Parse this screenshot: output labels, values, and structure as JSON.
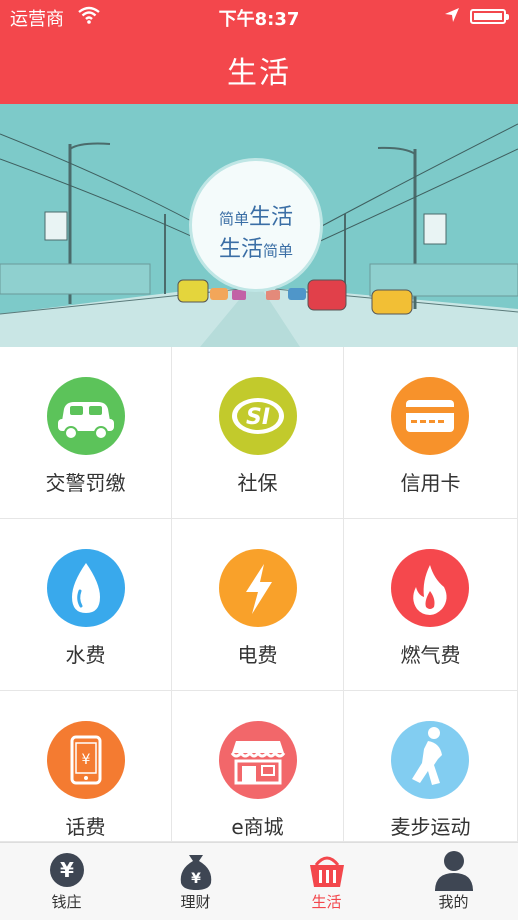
{
  "status_bar": {
    "carrier": "运营商",
    "time": "下午8:37"
  },
  "header": {
    "title": "生活"
  },
  "banner": {
    "line1_small": "简单",
    "line1_big": "生活",
    "line2_big": "生活",
    "line2_small": "简单"
  },
  "services": [
    {
      "label": "交警罚缴",
      "icon": "car-icon",
      "color": "#5cc35a"
    },
    {
      "label": "社保",
      "icon": "social-security-icon",
      "color": "#c2ca2c"
    },
    {
      "label": "信用卡",
      "icon": "credit-card-icon",
      "color": "#f7922b"
    },
    {
      "label": "水费",
      "icon": "water-drop-icon",
      "color": "#39a9ec"
    },
    {
      "label": "电费",
      "icon": "lightning-icon",
      "color": "#f9a12a"
    },
    {
      "label": "燃气费",
      "icon": "flame-icon",
      "color": "#f5484d"
    },
    {
      "label": "话费",
      "icon": "phone-bill-icon",
      "color": "#f47b31"
    },
    {
      "label": "e商城",
      "icon": "store-icon",
      "color": "#f2676a"
    },
    {
      "label": "麦步运动",
      "icon": "runner-icon",
      "color": "#82cdf1"
    }
  ],
  "tabs": [
    {
      "label": "钱庄",
      "icon": "yen-coin-icon",
      "active": false
    },
    {
      "label": "理财",
      "icon": "money-bag-icon",
      "active": false
    },
    {
      "label": "生活",
      "icon": "basket-icon",
      "active": true
    },
    {
      "label": "我的",
      "icon": "person-icon",
      "active": false
    }
  ],
  "colors": {
    "header": "#f3474c",
    "banner": "#7dcac9",
    "active_tab": "#f3474c"
  }
}
